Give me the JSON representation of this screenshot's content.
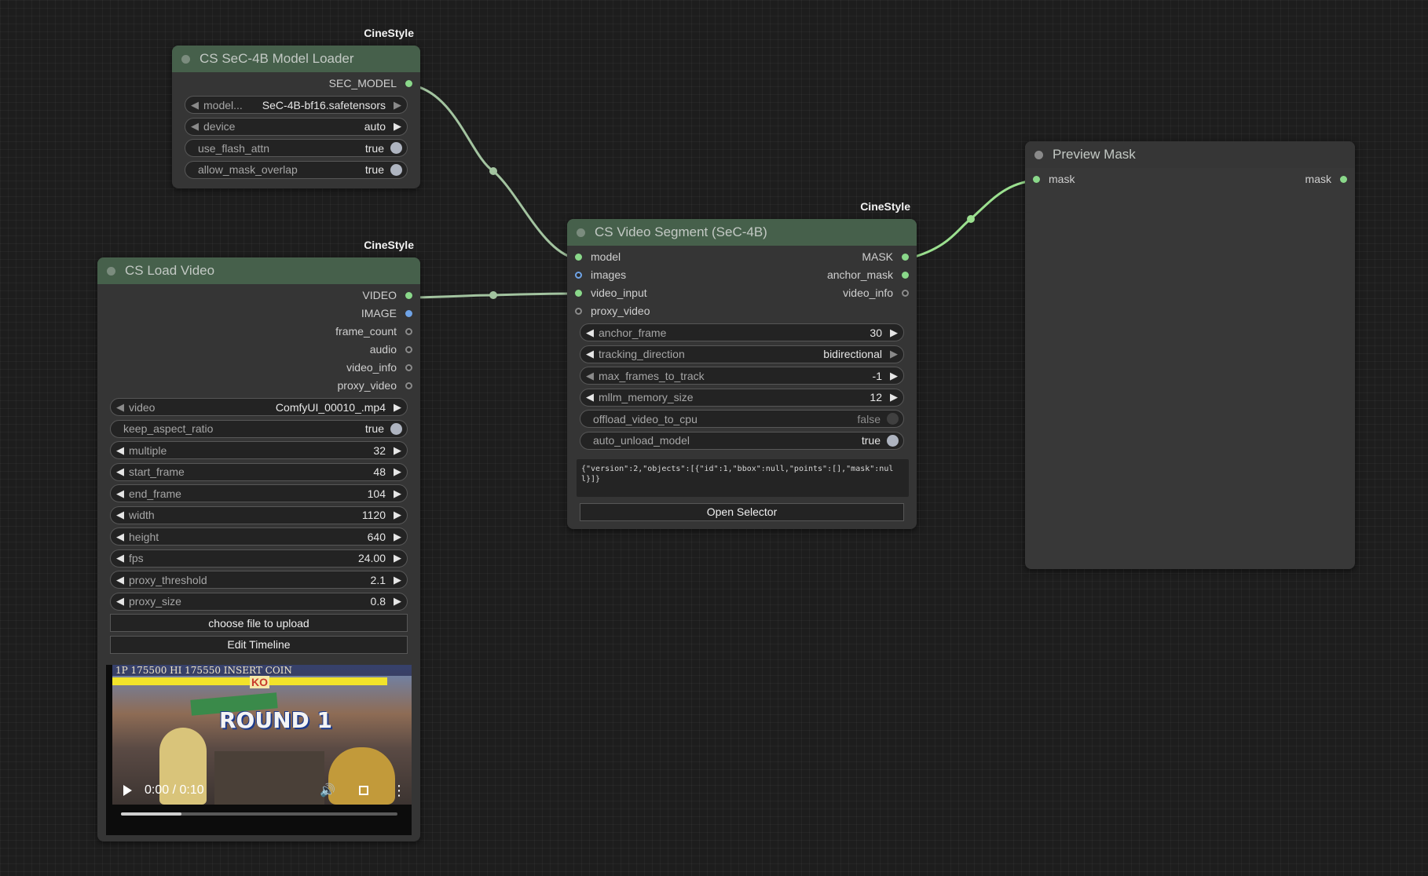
{
  "colors": {
    "canvas": "#1d1d1d",
    "node_body": "#353535",
    "node_header_green": "#46604b",
    "node_header_grey": "#363636",
    "wire": "#a3c4a0",
    "wire_bright": "#9be08f",
    "slot_green": "#8ad88a",
    "slot_blue": "#6fa3e6"
  },
  "model_loader": {
    "badge": "CineStyle",
    "title": "CS SeC-4B Model Loader",
    "outputs": [
      {
        "label": "SEC_MODEL",
        "type": "green"
      }
    ],
    "widgets": [
      {
        "kind": "combo",
        "name": "model...",
        "value": "SeC-4B-bf16.safetensors"
      },
      {
        "kind": "combo",
        "name": "device",
        "value": "auto"
      },
      {
        "kind": "toggle",
        "name": "use_flash_attn",
        "value": "true",
        "on": true
      },
      {
        "kind": "toggle",
        "name": "allow_mask_overlap",
        "value": "true",
        "on": true
      }
    ]
  },
  "load_video": {
    "badge": "CineStyle",
    "title": "CS Load Video",
    "outputs": [
      {
        "label": "VIDEO",
        "type": "green"
      },
      {
        "label": "IMAGE",
        "type": "blue"
      },
      {
        "label": "frame_count",
        "type": "hollow"
      },
      {
        "label": "audio",
        "type": "hollow"
      },
      {
        "label": "video_info",
        "type": "hollow"
      },
      {
        "label": "proxy_video",
        "type": "hollow"
      }
    ],
    "widgets": [
      {
        "kind": "combo",
        "name": "video",
        "value": "ComfyUI_00010_.mp4"
      },
      {
        "kind": "toggle",
        "name": "keep_aspect_ratio",
        "value": "true",
        "on": true
      },
      {
        "kind": "number",
        "name": "multiple",
        "value": "32"
      },
      {
        "kind": "number",
        "name": "start_frame",
        "value": "48"
      },
      {
        "kind": "number",
        "name": "end_frame",
        "value": "104"
      },
      {
        "kind": "number",
        "name": "width",
        "value": "1120"
      },
      {
        "kind": "number",
        "name": "height",
        "value": "640"
      },
      {
        "kind": "number",
        "name": "fps",
        "value": "24.00"
      },
      {
        "kind": "number",
        "name": "proxy_threshold",
        "value": "2.1"
      },
      {
        "kind": "number",
        "name": "proxy_size",
        "value": "0.8"
      }
    ],
    "buttons": [
      "choose file to upload",
      "Edit Timeline"
    ],
    "preview": {
      "time": "0:00 / 0:10",
      "progress_fraction": 0.22,
      "hud_text": "1P 175500 HI 175550 INSERT COIN",
      "ko_text": "KO",
      "round_text": "ROUND 1"
    }
  },
  "video_segment": {
    "badge": "CineStyle",
    "title": "CS Video Segment (SeC-4B)",
    "rows": [
      {
        "in": "model",
        "in_type": "green",
        "out": "MASK",
        "out_type": "green"
      },
      {
        "in": "images",
        "in_type": "blue",
        "out": "anchor_mask",
        "out_type": "green"
      },
      {
        "in": "video_input",
        "in_type": "green",
        "out": "video_info",
        "out_type": "hollow"
      },
      {
        "in": "proxy_video",
        "in_type": "hollow",
        "out": "",
        "out_type": ""
      }
    ],
    "widgets": [
      {
        "kind": "number",
        "name": "anchor_frame",
        "value": "30"
      },
      {
        "kind": "combo",
        "name": "tracking_direction",
        "value": "bidirectional"
      },
      {
        "kind": "number",
        "name": "max_frames_to_track",
        "value": "-1"
      },
      {
        "kind": "number",
        "name": "mllm_memory_size",
        "value": "12"
      },
      {
        "kind": "toggle",
        "name": "offload_video_to_cpu",
        "value": "false",
        "on": false
      },
      {
        "kind": "toggle",
        "name": "auto_unload_model",
        "value": "true",
        "on": true
      }
    ],
    "json_text": "{\"version\":2,\"objects\":[{\"id\":1,\"bbox\":null,\"points\":[],\"mask\":null}]}",
    "button": "Open Selector"
  },
  "preview_mask": {
    "title": "Preview Mask",
    "input": "mask",
    "output": "mask"
  }
}
